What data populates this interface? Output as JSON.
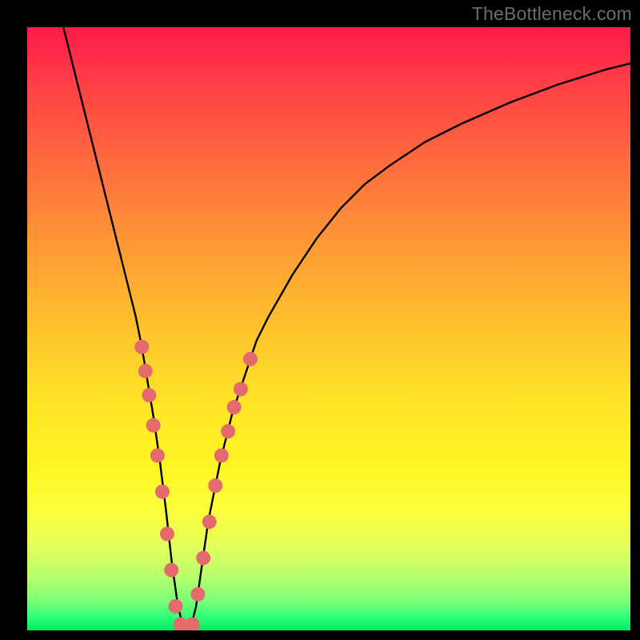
{
  "watermark": "TheBottleneck.com",
  "chart_data": {
    "type": "line",
    "title": "",
    "xlabel": "",
    "ylabel": "",
    "xlim": [
      0,
      100
    ],
    "ylim": [
      0,
      100
    ],
    "curve": {
      "x": [
        6,
        8,
        10,
        12,
        14,
        16,
        18,
        19,
        20,
        21,
        22,
        23,
        24,
        25,
        26,
        27,
        28,
        29,
        30,
        32,
        34,
        36,
        38,
        40,
        44,
        48,
        52,
        56,
        60,
        66,
        72,
        80,
        88,
        96,
        100
      ],
      "y": [
        100,
        92,
        84,
        76,
        68,
        60,
        52,
        47,
        41,
        35,
        28,
        20,
        11,
        4,
        0,
        0,
        4,
        11,
        18,
        28,
        36,
        42,
        48,
        52,
        59,
        65,
        70,
        74,
        77,
        81,
        84,
        87.5,
        90.5,
        93,
        94
      ]
    },
    "markers": [
      {
        "x": 19.0,
        "y": 47
      },
      {
        "x": 19.6,
        "y": 43
      },
      {
        "x": 20.2,
        "y": 39
      },
      {
        "x": 20.9,
        "y": 34
      },
      {
        "x": 21.6,
        "y": 29
      },
      {
        "x": 22.4,
        "y": 23
      },
      {
        "x": 23.2,
        "y": 16
      },
      {
        "x": 23.9,
        "y": 10
      },
      {
        "x": 24.6,
        "y": 4
      },
      {
        "x": 25.4,
        "y": 1
      },
      {
        "x": 26.4,
        "y": 0
      },
      {
        "x": 27.4,
        "y": 1
      },
      {
        "x": 28.3,
        "y": 6
      },
      {
        "x": 29.2,
        "y": 12
      },
      {
        "x": 30.2,
        "y": 18
      },
      {
        "x": 31.2,
        "y": 24
      },
      {
        "x": 32.2,
        "y": 29
      },
      {
        "x": 33.3,
        "y": 33
      },
      {
        "x": 34.3,
        "y": 37
      },
      {
        "x": 35.4,
        "y": 40
      },
      {
        "x": 37.0,
        "y": 45
      }
    ],
    "colors": {
      "curve": "#000000",
      "marker_fill": "#e46a6e",
      "marker_stroke": "#e46a6e"
    }
  }
}
